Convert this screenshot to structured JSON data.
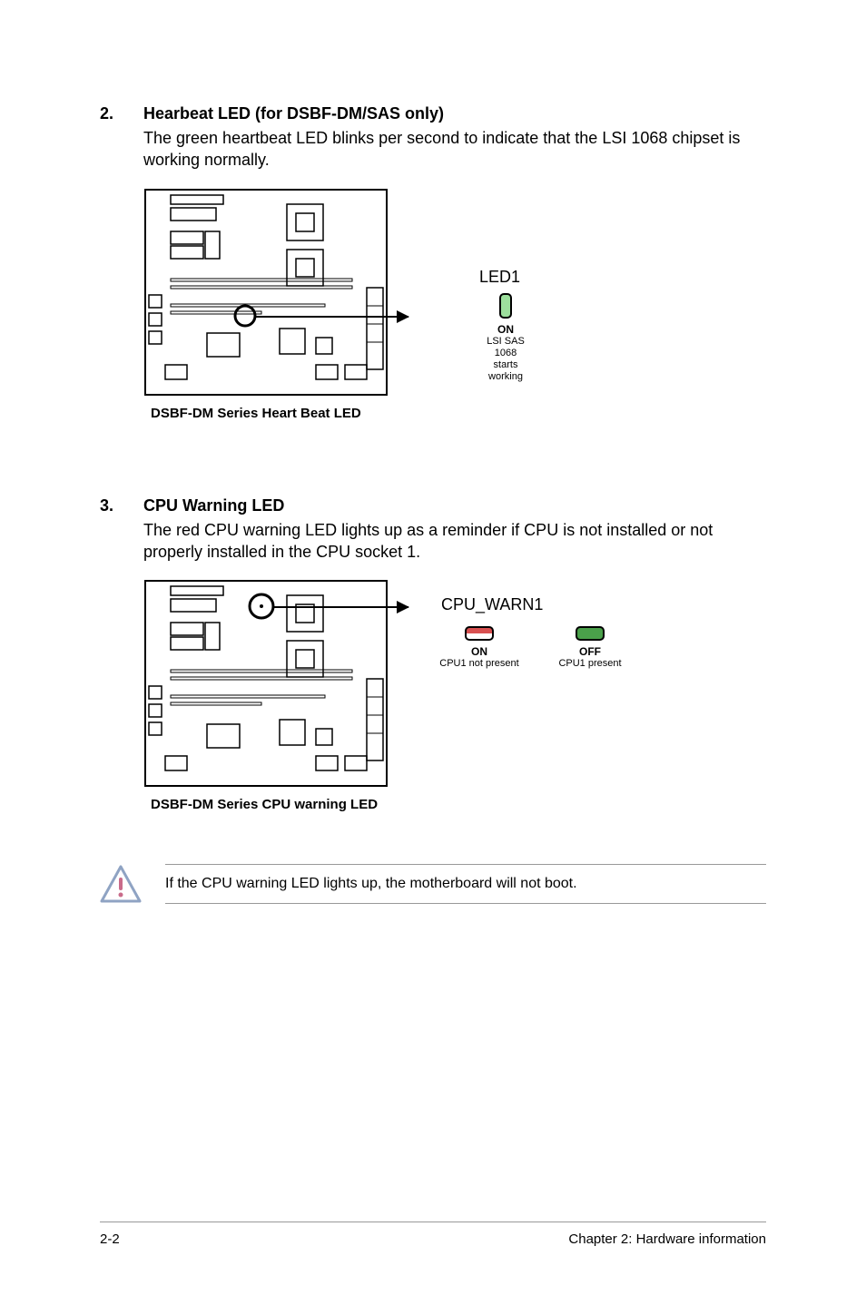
{
  "sections": [
    {
      "number": "2.",
      "title": "Hearbeat LED (for DSBF-DM/SAS only)",
      "body": "The green heartbeat LED blinks per second to indicate that the LSI 1068 chipset is working normally.",
      "caption": "DSBF-DM Series Heart Beat LED"
    },
    {
      "number": "3.",
      "title": "CPU Warning LED",
      "body": "The red CPU warning LED lights up as a reminder if CPU is not installed or not properly installed in the CPU socket 1.",
      "caption": "DSBF-DM Series CPU warning LED"
    }
  ],
  "led1": {
    "label": "LED1",
    "state": "ON",
    "sub1": "LSI SAS 1068",
    "sub2": "starts working"
  },
  "cpu_warn": {
    "label": "CPU_WARN1",
    "on_label": "ON",
    "on_sub": "CPU1 not present",
    "off_label": "OFF",
    "off_sub": "CPU1 present"
  },
  "note": "If the CPU warning LED lights up, the motherboard will not boot.",
  "footer": {
    "left": "2-2",
    "right": "Chapter 2: Hardware information"
  }
}
